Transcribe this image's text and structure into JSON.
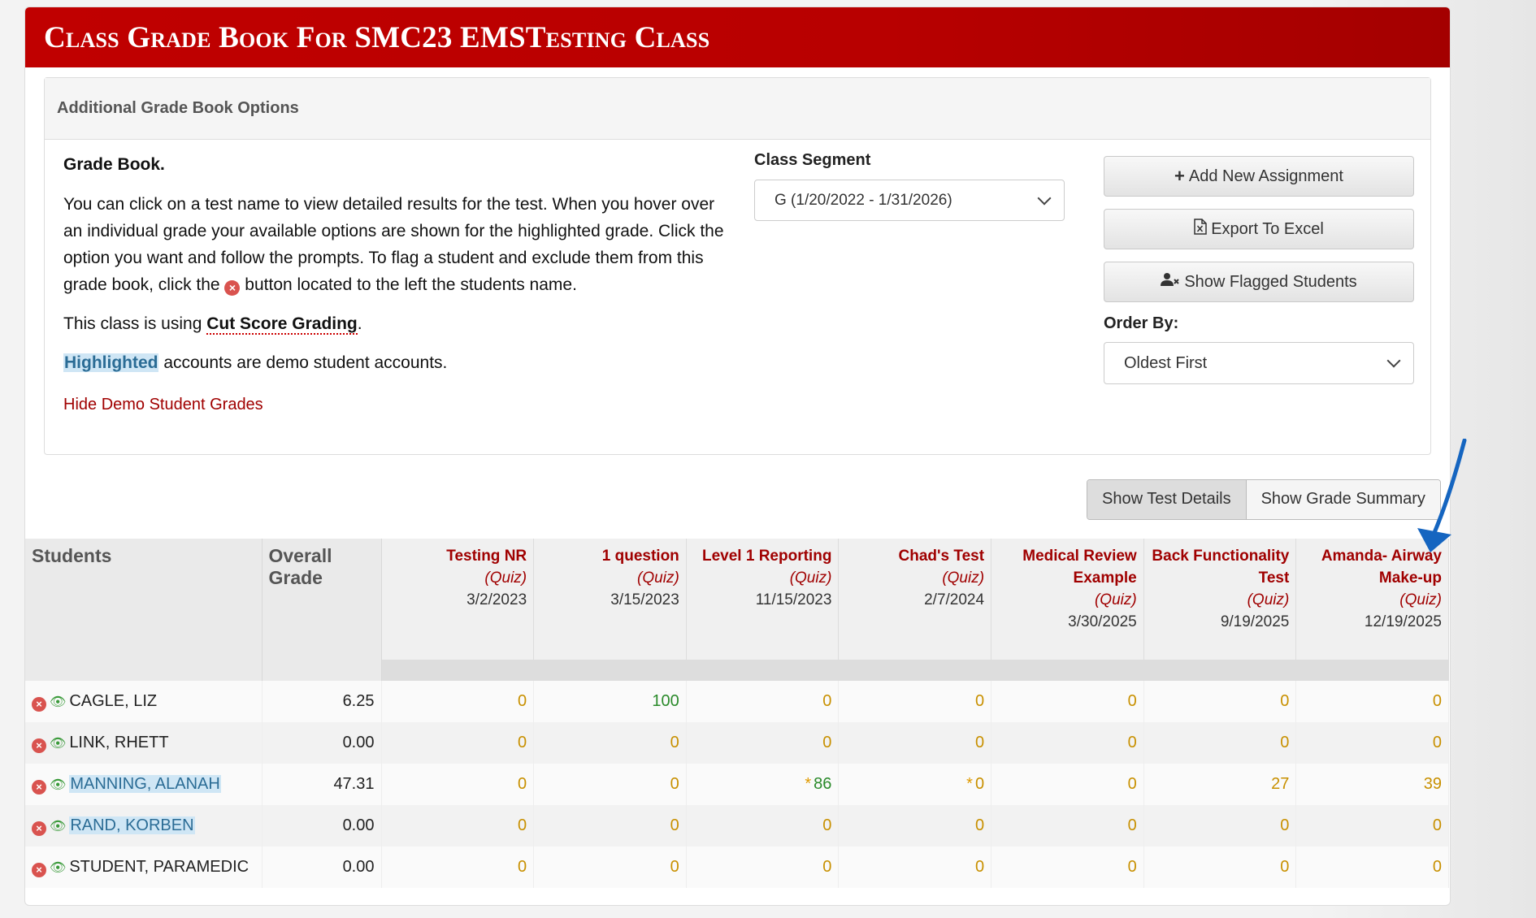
{
  "header": {
    "title": "Class Grade Book For SMC23 EMSTesting Class"
  },
  "options": {
    "heading": "Additional Grade Book Options",
    "gradebook_title": "Grade Book.",
    "instructions_1": "You can click on a test name to view detailed results for the test. When you hover over an individual grade your available options are shown for the highlighted grade. Click the option you want and follow the prompts. To flag a student and exclude them from this grade book, click the",
    "instructions_2": "button located to the left the students name.",
    "grading_prefix": "This class is using",
    "grading_method": "Cut Score Grading",
    "grading_suffix": ".",
    "highlight_word": "Highlighted",
    "highlight_suffix": "accounts are demo student accounts.",
    "hide_demo_link": "Hide Demo Student Grades",
    "segment_label": "Class Segment",
    "segment_value": "G (1/20/2022 - 1/31/2026)",
    "buttons": {
      "add_assignment": "Add New Assignment",
      "export_excel": "Export To Excel",
      "show_flagged": "Show Flagged Students"
    },
    "order_label": "Order By:",
    "order_value": "Oldest First"
  },
  "view_toggle": {
    "details": "Show Test Details",
    "summary": "Show Grade Summary"
  },
  "table": {
    "col_students": "Students",
    "col_overall_1": "Overall",
    "col_overall_2": "Grade",
    "tests": [
      {
        "name": "Testing NR",
        "type": "(Quiz)",
        "date": "3/2/2023"
      },
      {
        "name": "1 question",
        "type": "(Quiz)",
        "date": "3/15/2023"
      },
      {
        "name": "Level 1 Reporting",
        "type": "(Quiz)",
        "date": "11/15/2023"
      },
      {
        "name": "Chad's Test",
        "type": "(Quiz)",
        "date": "2/7/2024"
      },
      {
        "name": "Medical Review Example",
        "type": "(Quiz)",
        "date": "3/30/2025"
      },
      {
        "name": "Back Functionality Test",
        "type": "(Quiz)",
        "date": "9/19/2025"
      },
      {
        "name": "Amanda- Airway Make-up",
        "type": "(Quiz)",
        "date": "12/19/2025"
      }
    ],
    "rows": [
      {
        "name": "CAGLE, LIZ",
        "overall": "6.25",
        "grades": [
          "0",
          "100",
          "0",
          "0",
          "0",
          "0",
          "0"
        ]
      },
      {
        "name": "LINK, RHETT",
        "overall": "0.00",
        "grades": [
          "0",
          "0",
          "0",
          "0",
          "0",
          "0",
          "0"
        ]
      },
      {
        "name": "MANNING, ALANAH",
        "overall": "47.31",
        "grades": [
          "0",
          "0",
          "86",
          "0",
          "0",
          "27",
          "39"
        ]
      },
      {
        "name": "RAND, KORBEN",
        "overall": "0.00",
        "grades": [
          "0",
          "0",
          "0",
          "0",
          "0",
          "0",
          "0"
        ]
      },
      {
        "name": "STUDENT, PARAMEDIC",
        "overall": "0.00",
        "grades": [
          "0",
          "0",
          "0",
          "0",
          "0",
          "0",
          "0"
        ]
      }
    ],
    "flag_mark": "*"
  },
  "colors": {
    "brand_red": "#b80000",
    "grade_low": "#c89000",
    "grade_pass": "#2a8a2a",
    "demo_highlight": "#cfe6f5"
  },
  "icons": {
    "flag_icon": "remove-circle-icon",
    "visibility_icon": "eye-slash-icon",
    "arrow": "pointer-arrow-icon"
  }
}
